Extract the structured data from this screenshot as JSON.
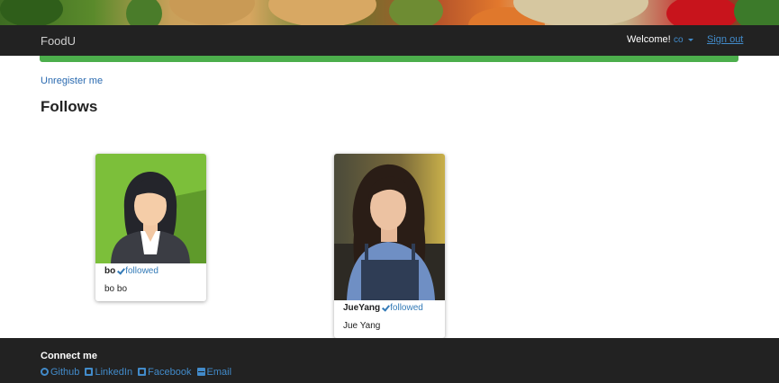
{
  "navbar": {
    "brand": "FoodU",
    "welcome": "Welcome!",
    "username": "co",
    "signout": "Sign out"
  },
  "actions": {
    "unregister": "Unregister me"
  },
  "page": {
    "heading": "Follows"
  },
  "follows": [
    {
      "username": "bo",
      "status": "followed",
      "full_name": "bo bo"
    },
    {
      "username": "JueYang",
      "status": "followed",
      "full_name": "Jue Yang"
    }
  ],
  "footer": {
    "title": "Connect me",
    "links": [
      {
        "label": "Github",
        "icon": "github-icon"
      },
      {
        "label": "LinkedIn",
        "icon": "linkedin-icon"
      },
      {
        "label": "Facebook",
        "icon": "facebook-icon"
      },
      {
        "label": "Email",
        "icon": "email-icon"
      }
    ]
  },
  "colors": {
    "navbar": "#222222",
    "link": "#428bca",
    "success_bar": "#4cae4c",
    "avatar_bg": "#7cbf3a"
  }
}
